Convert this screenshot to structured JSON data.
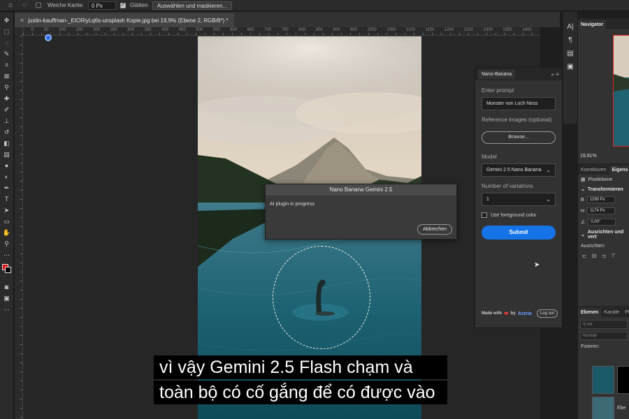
{
  "options_bar": {
    "feather_label": "Weiche Kante:",
    "feather_value": "0 Px",
    "antialias_label": "Glätten",
    "select_mask_button": "Auswählen und maskieren..."
  },
  "document": {
    "tab_title": "justin-kauffman-_EtORiyLq6s-unsplash Kopie.jpg bei 19,9% (Ebene 2, RGB/8*) *",
    "close_glyph": "×"
  },
  "ruler_ticks": [
    "0",
    "50",
    "100",
    "150",
    "200",
    "250",
    "300",
    "350",
    "400",
    "450",
    "500",
    "550",
    "600",
    "650",
    "700",
    "750",
    "800",
    "850",
    "900",
    "950",
    "1000",
    "1050",
    "1100",
    "1150",
    "1200",
    "1250",
    "1300",
    "1350",
    "1400"
  ],
  "plugin": {
    "tab": "Nano-Banana",
    "collapse_glyph": "»",
    "menu_glyph": "≡",
    "prompt_label": "Enter prompt",
    "prompt_value": "Monster von Loch Ness",
    "reference_label": "Reference images (optional)",
    "browse_button": "Browse...",
    "model_label": "Model",
    "model_value": "Gemini 2.5 Nano Banana",
    "variations_label": "Number of variations",
    "variations_value": "1",
    "foreground_label": "Use foreground color",
    "submit_button": "Submit",
    "made_with": "Made with",
    "by": "by",
    "brand": "Astria",
    "logout_button": "Log out"
  },
  "dialog": {
    "title": "Nano Banana Gemini 2.5",
    "message": "AI plugin in progress",
    "cancel_button": "Abbrechen"
  },
  "right_panel": {
    "navigator_tab": "Navigator",
    "zoom": "19,91%",
    "corrections_tab": "Korrekturen",
    "properties_tab": "Eigens",
    "pixel_layer": "Pixelebene",
    "transform_header": "Transformieren",
    "width_label": "B",
    "width_value": "1299 Px",
    "height_label": "H",
    "height_value": "1174 Px",
    "angle_value": "0,00°",
    "align_header": "Ausrichten und vert",
    "align_label": "Ausrichten:",
    "layers_tab": "Ebenen",
    "channels_tab": "Kanäle",
    "paths_tab": "Pf",
    "search_placeholder": "Art",
    "blend_mode": "Normal",
    "lock_label": "Fixieren:",
    "layer_name_partial": "Ebe"
  },
  "caption": {
    "line1": "vì vậy Gemini 2.5 Flash chạm và",
    "line2": "toàn bộ có cố gắng để có được vào"
  },
  "colors": {
    "accent": "#1473e6",
    "foreground_swatch": "#e01010",
    "background_swatch": "#000000"
  }
}
